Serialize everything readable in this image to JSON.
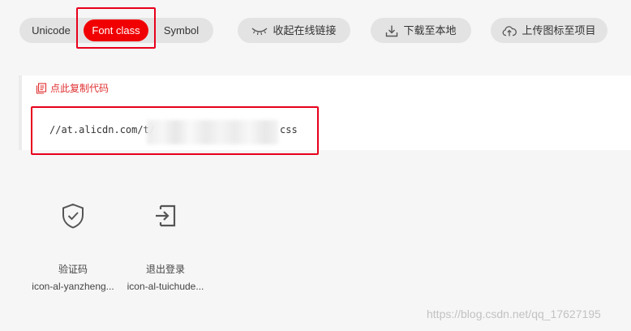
{
  "tabs": {
    "items": [
      {
        "label": "Unicode",
        "selected": false
      },
      {
        "label": "Font class",
        "selected": true
      },
      {
        "label": "Symbol",
        "selected": false
      }
    ]
  },
  "actions": {
    "update_link": {
      "label": "收起在线链接",
      "icon": "eye-closed-icon"
    },
    "download": {
      "label": "下载至本地",
      "icon": "download-icon"
    },
    "upload": {
      "label": "上传图标至项目",
      "icon": "cloud-upload-icon"
    }
  },
  "code": {
    "copy_label": "点此复制代码",
    "url_prefix": "//at.alicdn.com/t/",
    "url_suffix": "css"
  },
  "icons": [
    {
      "name": "验证码",
      "class": "icon-al-yanzheng...",
      "glyph": "shield-check-icon"
    },
    {
      "name": "退出登录",
      "class": "icon-al-tuichude...",
      "glyph": "logout-icon"
    }
  ],
  "colors": {
    "accent": "#f00000",
    "highlight": "#e8001c",
    "copy_link": "#e03030"
  },
  "watermark": "https://blog.csdn.net/qq_17627195"
}
